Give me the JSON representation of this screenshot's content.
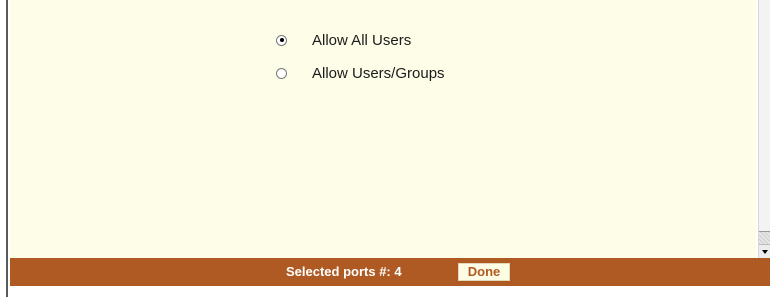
{
  "access_options": [
    {
      "label": "Allow All Users",
      "selected": true
    },
    {
      "label": "Allow Users/Groups",
      "selected": false
    }
  ],
  "footer": {
    "ports_label": "Selected ports #: 4",
    "done_label": "Done"
  },
  "colors": {
    "content_bg": "#fdfde8",
    "footer_bg": "#b05a23",
    "footer_text": "#ffffff",
    "button_bg": "#fdfde6",
    "button_text": "#b05a23"
  },
  "icons": {
    "radio_selected": "radio-checked-icon",
    "radio_unselected": "radio-unchecked-icon",
    "scroll_down": "scroll-down-arrow-icon"
  }
}
